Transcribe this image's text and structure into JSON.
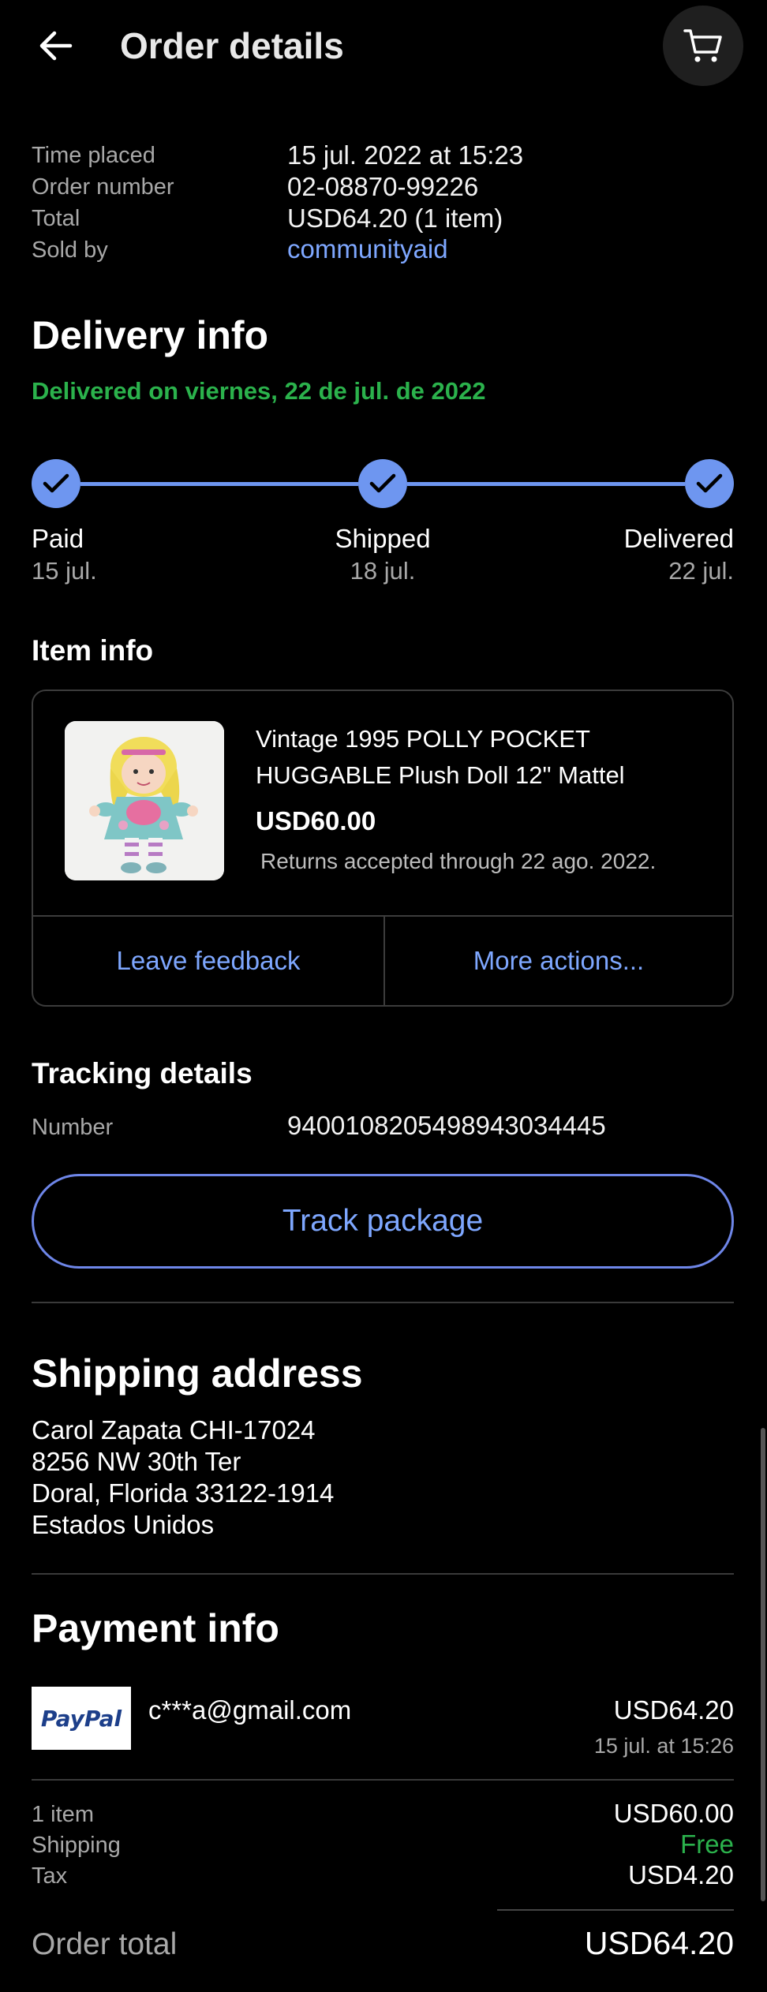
{
  "header": {
    "title": "Order details",
    "back_icon": "arrow-left-icon",
    "cart_icon": "cart-icon"
  },
  "summary": {
    "time_placed_label": "Time placed",
    "time_placed_value": "15 jul. 2022 at 15:23",
    "order_number_label": "Order number",
    "order_number_value": "02-08870-99226",
    "total_label": "Total",
    "total_value": "USD64.20 (1 item)",
    "sold_by_label": "Sold by",
    "sold_by_value": "communityaid"
  },
  "delivery": {
    "title": "Delivery info",
    "status": "Delivered on viernes, 22 de jul. de 2022",
    "steps": [
      {
        "label": "Paid",
        "date": "15 jul."
      },
      {
        "label": "Shipped",
        "date": "18 jul."
      },
      {
        "label": "Delivered",
        "date": "22 jul."
      }
    ]
  },
  "item": {
    "section_title": "Item info",
    "title": "Vintage 1995 POLLY POCKET HUGGABLE Plush Doll 12\" Mattel",
    "price": "USD60.00",
    "returns": "Returns accepted through 22 ago. 2022.",
    "leave_feedback": "Leave feedback",
    "more_actions": "More actions..."
  },
  "tracking": {
    "title": "Tracking details",
    "number_label": "Number",
    "number_value": "9400108205498943034445",
    "track_button": "Track package"
  },
  "shipping": {
    "title": "Shipping address",
    "lines": [
      "Carol Zapata CHI-17024",
      "8256 NW 30th Ter",
      "Doral, Florida 33122-1914",
      "Estados Unidos"
    ]
  },
  "payment": {
    "title": "Payment info",
    "paypal_logo": "PayPal",
    "email": "c***a@gmail.com",
    "amount": "USD64.20",
    "date": "15 jul. at 15:26",
    "items_label": "1 item",
    "items_value": "USD60.00",
    "shipping_label": "Shipping",
    "shipping_value": "Free",
    "tax_label": "Tax",
    "tax_value": "USD4.20",
    "total_label": "Order total",
    "total_value": "USD64.20"
  },
  "colors": {
    "accent_blue": "#7ea7ff",
    "success_green": "#2bb24c",
    "background": "#000000"
  }
}
